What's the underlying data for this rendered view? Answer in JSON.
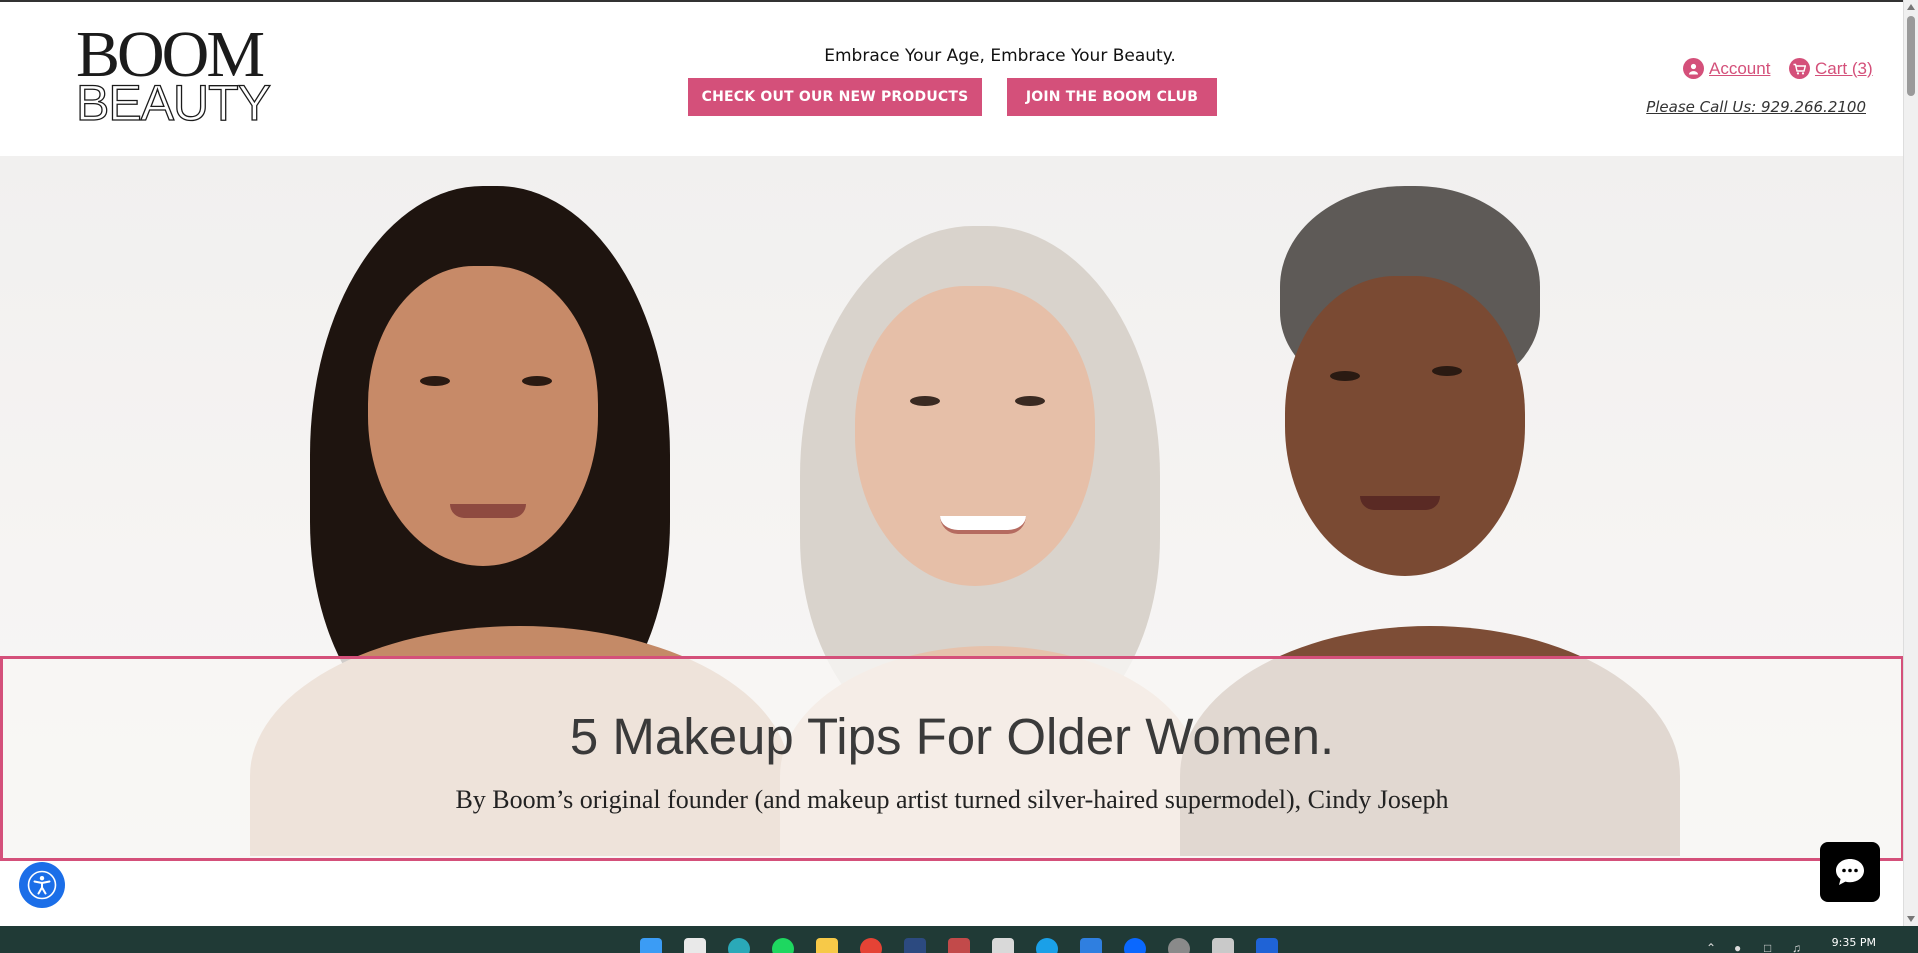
{
  "brand": {
    "logo_line1": "BOOM",
    "logo_line2": "BEAUTY",
    "accent_color": "#d4507a"
  },
  "header": {
    "tagline": "Embrace Your Age, Embrace Your Beauty.",
    "buttons": {
      "new_products": "CHECK OUT OUR NEW PRODUCTS",
      "boom_club": "JOIN THE BOOM CLUB"
    },
    "account_label": "Account",
    "cart_label": "Cart (3)",
    "phone": "Please Call Us: 929.266.2100"
  },
  "hero": {
    "image_alt": "Three smiling women of different ages",
    "title": "5 Makeup Tips For Older Women.",
    "subtitle": "By Boom’s original founder (and makeup artist turned silver-haired supermodel), Cindy Joseph"
  },
  "widgets": {
    "accessibility": "accessibility-icon",
    "chat": "chat-icon"
  },
  "taskbar": {
    "clock": "9:35 PM",
    "apps": [
      "windows-start",
      "snipping-tool",
      "edge",
      "spotify",
      "file-explorer",
      "chrome",
      "app",
      "app",
      "app",
      "skype",
      "app",
      "zalo",
      "settings",
      "app",
      "app"
    ]
  }
}
